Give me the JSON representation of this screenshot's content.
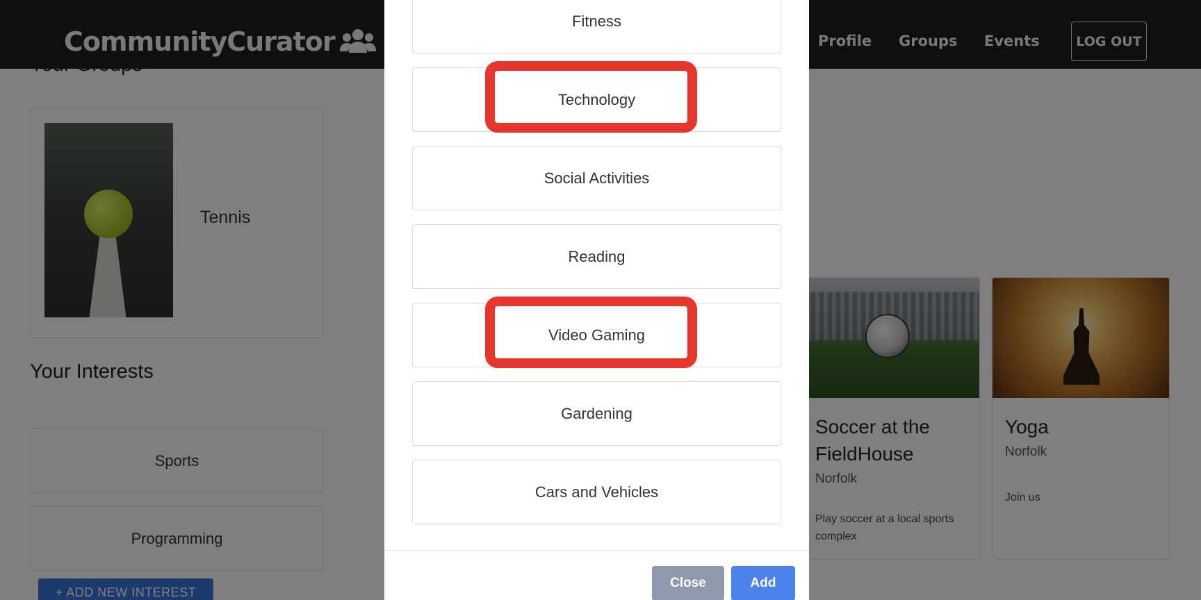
{
  "navbar": {
    "brand": "CommunityCurator",
    "links": {
      "profile": "Profile",
      "groups": "Groups",
      "events": "Events"
    },
    "logout_label": "LOG OUT"
  },
  "page": {
    "groups_title": "Your Groups",
    "groups": [
      {
        "name": "Tennis"
      }
    ],
    "interests_title": "Your Interests",
    "interests": [
      "Sports",
      "Programming"
    ],
    "add_interest_label": "+ ADD NEW INTEREST",
    "events": [
      {
        "title": "Soccer at the FieldHouse",
        "location": "Norfolk",
        "description": "Play soccer at a local sports complex"
      },
      {
        "title": "Yoga",
        "location": "Norfolk",
        "description": "Join us"
      }
    ]
  },
  "modal": {
    "options": [
      "Fitness",
      "Technology",
      "Social Activities",
      "Reading",
      "Video Gaming",
      "Gardening",
      "Cars and Vehicles"
    ],
    "highlighted_options": [
      "Technology",
      "Video Gaming"
    ],
    "close_label": "Close",
    "add_label": "Add"
  },
  "colors": {
    "navbar_bg": "#1f1f1f",
    "highlight": "#e8352c",
    "add_button": "#4a82ea",
    "close_button": "#8e9aab",
    "primary_button": "#3a75d9"
  },
  "icons": {
    "brand_icon": "users-icon"
  }
}
